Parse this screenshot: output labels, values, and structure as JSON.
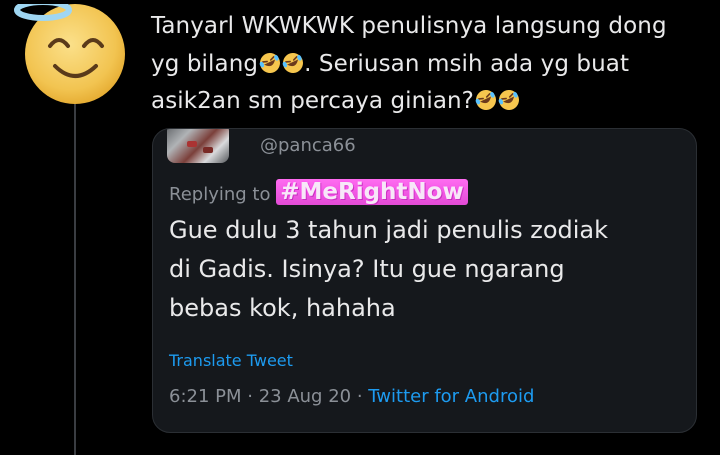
{
  "reply_tweet": {
    "text_line_1": "Tanyarl WKWKWK penulisnya langsung dong",
    "text_line_2a": "yg bilang",
    "text_line_2b": ". Seriusan msih ada yg buat",
    "text_line_3a": "asik2an sm percaya ginian?",
    "avatar_icon": "smiling-face-with-halo-icon",
    "emoji_icon": "rolling-on-floor-laughing-icon"
  },
  "quoted_tweet": {
    "handle": "@panca66",
    "replying_prefix": "Replying to",
    "replying_hashtag": "#MeRightNow",
    "text": "Gue dulu 3 tahun jadi penulis zodiak\ndi Gadis. Isinya? Itu gue ngarang\nbebas kok, hahaha",
    "translate_label": "Translate Tweet",
    "time": "6:21 PM",
    "separator": " · ",
    "date": "23 Aug 20",
    "source": "Twitter for Android"
  },
  "colors": {
    "background": "#000000",
    "card": "#15181c",
    "link": "#1d9bf0",
    "secondary_text": "#8b9097",
    "hashtag_highlight": "#ff6cf1"
  }
}
